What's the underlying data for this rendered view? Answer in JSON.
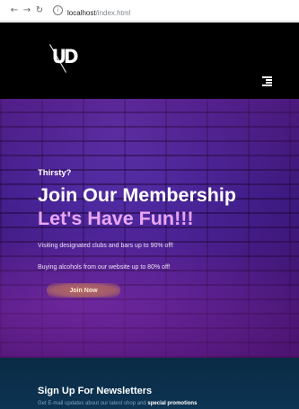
{
  "browser": {
    "back_icon": "arrow-left-icon",
    "forward_icon": "arrow-right-icon",
    "reload_icon": "reload-icon",
    "info_icon": "info-icon",
    "url_host": "localhost",
    "url_path": "/index.html"
  },
  "header": {
    "logo_text": "UD",
    "menu_icon": "menu-icon",
    "background": "#000000"
  },
  "hero": {
    "kicker": "Thirsty?",
    "title": "Join Our Membership",
    "subtitle": "Let's Have Fun!!!",
    "line1": "Visiting designated clubs and bars up to 90% off!",
    "line2": "Buying alcohols from our website up to 80% off!",
    "button_label": "Join Now",
    "subtitle_color": "#e9a7f3"
  },
  "newsletter": {
    "title": "Sign Up For Newsletters",
    "text_prefix": "Get E-mail updates about our latest shop and ",
    "text_highlight": "special promotions",
    "background": "#0b2e49"
  }
}
